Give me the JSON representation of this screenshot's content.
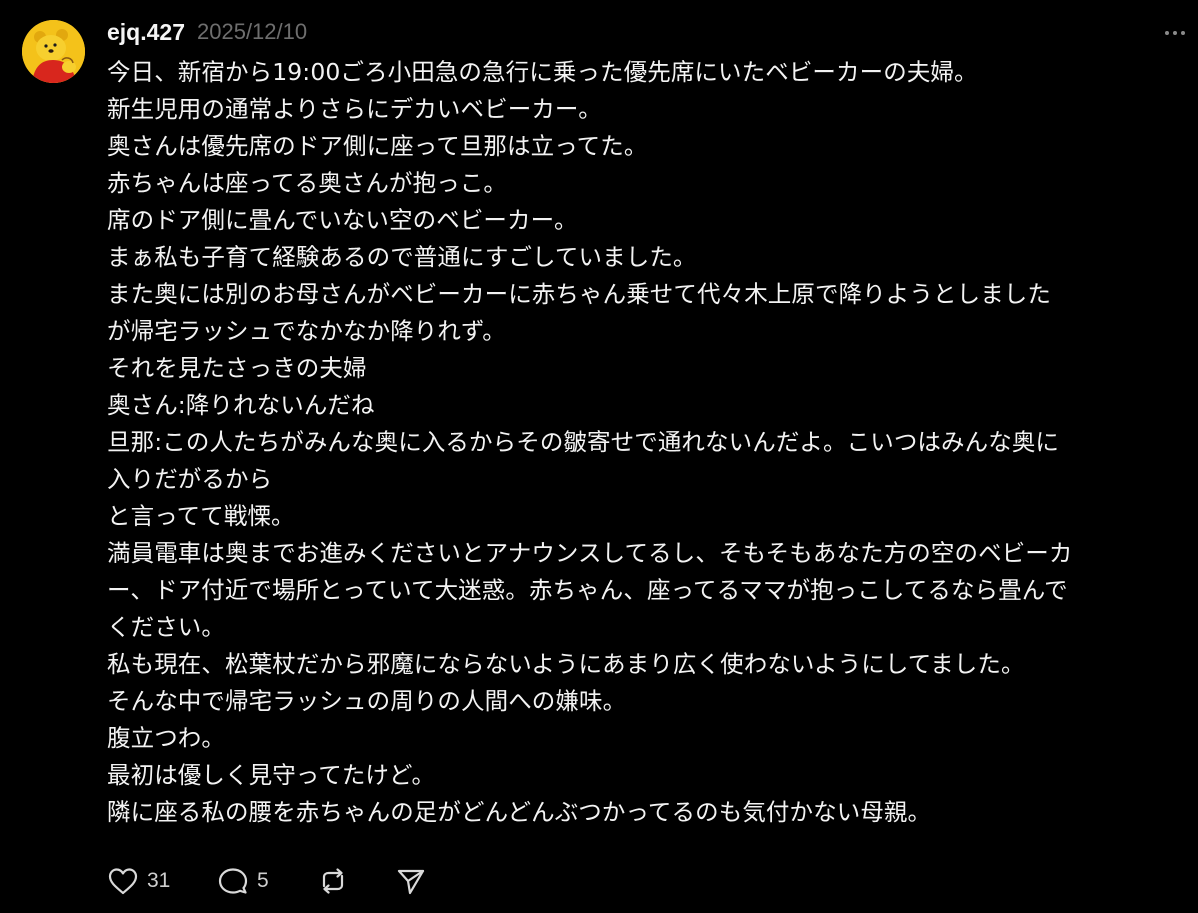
{
  "post": {
    "username": "ejq.427",
    "date": "2025/12/10",
    "body_lines": [
      "今日、新宿から19:00ごろ小田急の急行に乗った優先席にいたベビーカーの夫婦。",
      "新生児用の通常よりさらにデカいベビーカー。",
      "奥さんは優先席のドア側に座って旦那は立ってた。",
      "赤ちゃんは座ってる奥さんが抱っこ。",
      "席のドア側に畳んでいない空のベビーカー。",
      "まぁ私も子育て経験あるので普通にすごしていました。",
      "また奥には別のお母さんがベビーカーに赤ちゃん乗せて代々木上原で降りようとしました",
      "が帰宅ラッシュでなかなか降りれず。",
      "それを見たさっきの夫婦",
      "奥さん:降りれないんだね",
      "旦那:この人たちがみんな奥に入るからその皺寄せで通れないんだよ。こいつはみんな奥に",
      "入りだがるから",
      "と言ってて戦慄。",
      "満員電車は奥までお進みくださいとアナウンスしてるし、そもそもあなた方の空のベビーカ",
      "ー、ドア付近で場所とっていて大迷惑。赤ちゃん、座ってるママが抱っこしてるなら畳んで",
      "ください。",
      "私も現在、松葉杖だから邪魔にならないようにあまり広く使わないようにしてました。",
      "そんな中で帰宅ラッシュの周りの人間への嫌味。",
      "腹立つわ。",
      "最初は優しく見守ってたけど。",
      "隣に座る私の腰を赤ちゃんの足がどんどんぶつかってるのも気付かない母親。"
    ]
  },
  "actions": {
    "like_count": "31",
    "reply_count": "5"
  },
  "icons": {
    "avatar": "bear-character-avatar",
    "more": "more-horizontal-icon",
    "like": "heart-icon",
    "reply": "comment-bubble-icon",
    "repost": "repost-icon",
    "share": "send-icon"
  },
  "colors": {
    "background": "#000000",
    "text": "#f3f3f3",
    "muted": "#6e6e6e",
    "avatar_yellow": "#f2c316",
    "avatar_red": "#d8261d"
  }
}
